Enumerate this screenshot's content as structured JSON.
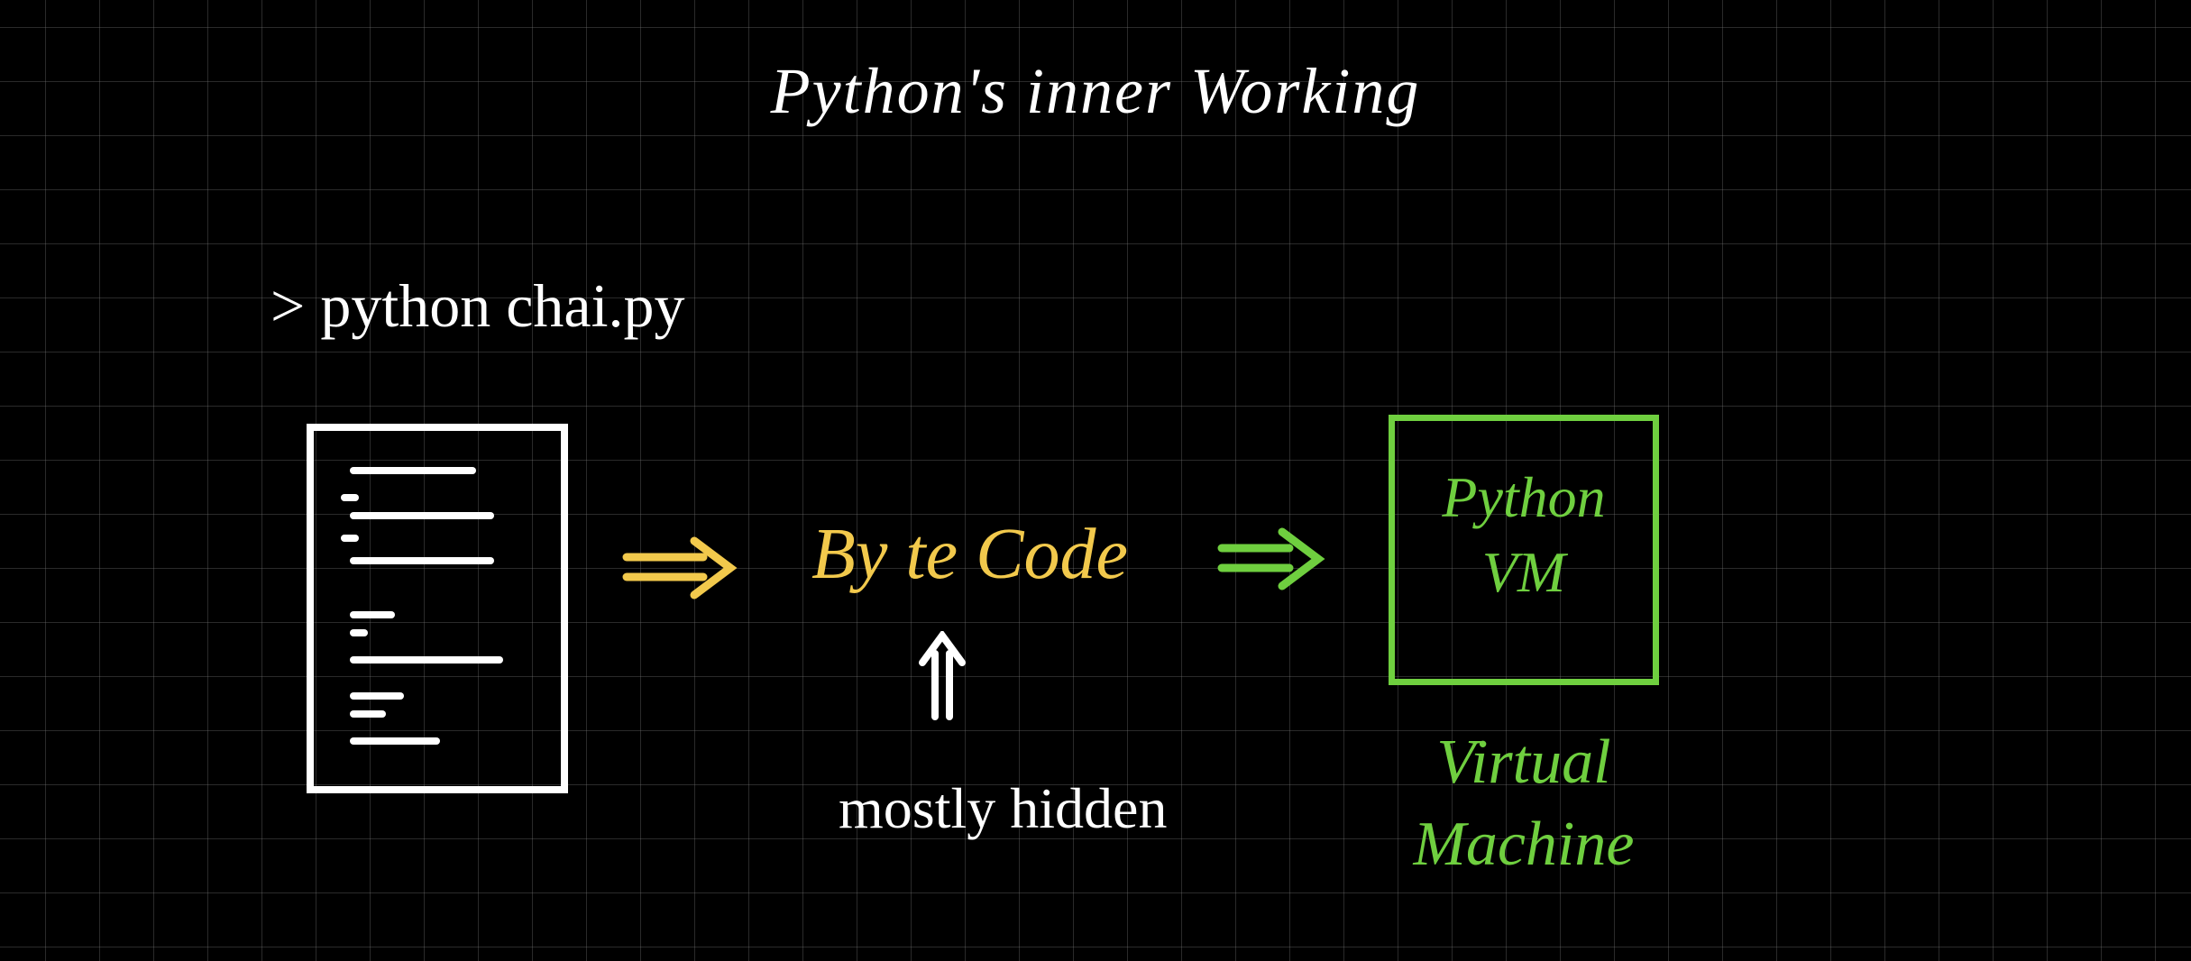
{
  "title": "Python's inner Working",
  "command": "> python  chai.py",
  "flow": {
    "bytecode_label": "By te  Code",
    "bytecode_note": "mostly hidden",
    "vm_box_line1": "Python",
    "vm_box_line2": "VM",
    "vm_caption_line1": "Virtual",
    "vm_caption_line2": "Machine"
  },
  "colors": {
    "grid": "#787878",
    "ink_white": "#ffffff",
    "ink_yellow": "#f2c94c",
    "ink_green": "#6FCF3F",
    "bg": "#000000"
  }
}
